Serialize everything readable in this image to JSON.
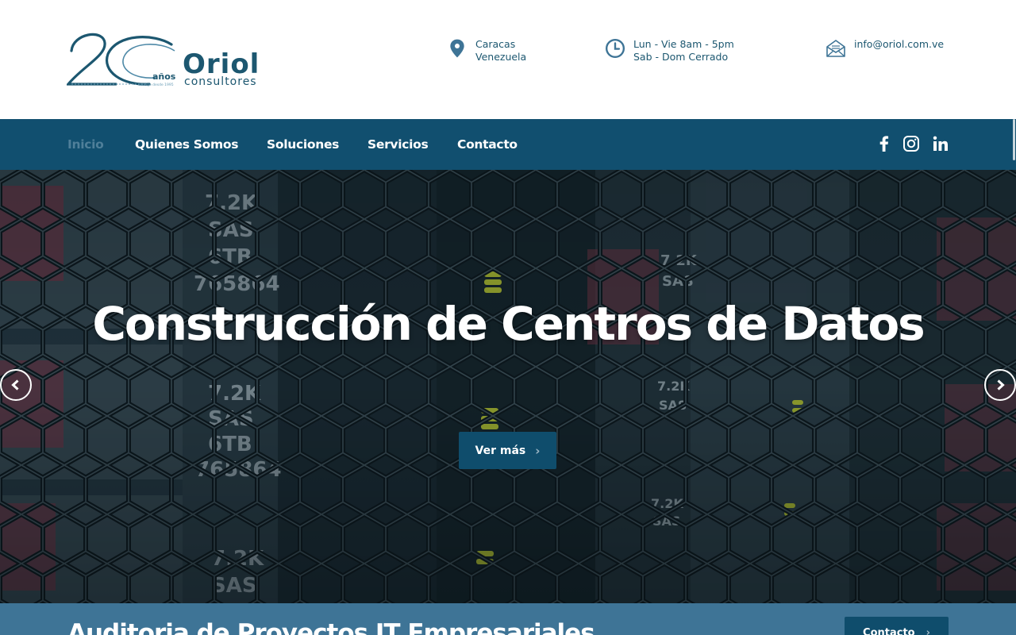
{
  "brand": {
    "logo_years": "años",
    "logo_name": "Oriol",
    "logo_sub": "consultores",
    "logo_tagline": "contigo desde 1995"
  },
  "contact_info": {
    "location_line1": "Caracas",
    "location_line2": "Venezuela",
    "hours_line1": "Lun - Vie 8am - 5pm",
    "hours_line2": "Sab - Dom Cerrado",
    "email": "info@oriol.com.ve",
    "icons": [
      "map-pin-icon",
      "clock-icon",
      "envelope-icon"
    ]
  },
  "nav": {
    "items": [
      {
        "label": "Inicio",
        "active": true
      },
      {
        "label": "Quienes Somos",
        "active": false
      },
      {
        "label": "Soluciones",
        "active": false
      },
      {
        "label": "Servicios",
        "active": false
      },
      {
        "label": "Contacto",
        "active": false
      }
    ],
    "social": [
      "facebook-icon",
      "instagram-icon",
      "linkedin-icon"
    ]
  },
  "hero": {
    "title": "Construcción de Centros de Datos",
    "button_label": "Ver más",
    "icons": [
      "chevron-left-icon",
      "chevron-right-icon"
    ]
  },
  "strip": {
    "title": "Auditoria de Proyectos IT Empresariales",
    "button_label": "Contacto"
  },
  "colors": {
    "nav_bg": "#114f6f",
    "accent": "#0f4d6c",
    "text": "#1c5770",
    "active_nav": "#4f7f99",
    "strip_bg": "#3e7496"
  }
}
